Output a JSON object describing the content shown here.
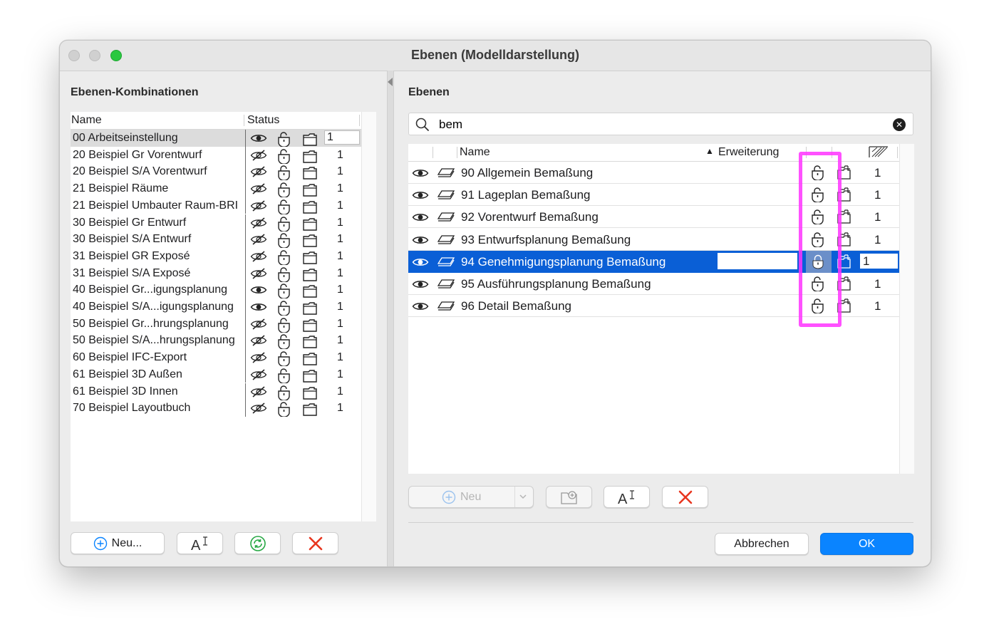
{
  "window": {
    "title": "Ebenen (Modelldarstellung)"
  },
  "left": {
    "section_title": "Ebenen-Kombinationen",
    "columns": {
      "name": "Name",
      "status": "Status"
    },
    "rows": [
      {
        "name": "00 Arbeitseinstellung",
        "visible": true,
        "num": "1",
        "selected": true
      },
      {
        "name": "20 Beispiel Gr Vorentwurf",
        "visible": false,
        "num": "1"
      },
      {
        "name": "20 Beispiel S/A Vorentwurf",
        "visible": false,
        "num": "1"
      },
      {
        "name": "21 Beispiel Räume",
        "visible": false,
        "num": "1"
      },
      {
        "name": "21 Beispiel Umbauter Raum-BRI",
        "visible": false,
        "num": "1"
      },
      {
        "name": "30 Beispiel Gr Entwurf",
        "visible": false,
        "num": "1"
      },
      {
        "name": "30 Beispiel S/A Entwurf",
        "visible": false,
        "num": "1"
      },
      {
        "name": "31 Beispiel GR Exposé",
        "visible": false,
        "num": "1"
      },
      {
        "name": "31 Beispiel S/A Exposé",
        "visible": false,
        "num": "1"
      },
      {
        "name": "40 Beispiel Gr...igungsplanung",
        "visible": true,
        "num": "1"
      },
      {
        "name": "40 Beispiel S/A...igungsplanung",
        "visible": true,
        "num": "1"
      },
      {
        "name": "50 Beispiel Gr...hrungsplanung",
        "visible": false,
        "num": "1"
      },
      {
        "name": "50 Beispiel S/A...hrungsplanung",
        "visible": false,
        "num": "1"
      },
      {
        "name": "60 Beispiel IFC-Export",
        "visible": false,
        "num": "1"
      },
      {
        "name": "61 Beispiel 3D Außen",
        "visible": false,
        "num": "1"
      },
      {
        "name": "61 Beispiel 3D Innen",
        "visible": false,
        "num": "1"
      },
      {
        "name": "70 Beispiel Layoutbuch",
        "visible": false,
        "num": "1"
      }
    ],
    "buttons": {
      "new": "Neu..."
    }
  },
  "right": {
    "section_title": "Ebenen",
    "search": {
      "value": "bem",
      "placeholder": ""
    },
    "columns": {
      "name": "Name",
      "extension": "Erweiterung"
    },
    "rows": [
      {
        "name": "90 Allgemein Bemaßung",
        "num": "1"
      },
      {
        "name": "91 Lageplan Bemaßung",
        "num": "1"
      },
      {
        "name": "92 Vorentwurf Bemaßung",
        "num": "1"
      },
      {
        "name": "93 Entwurfsplanung Bemaßung",
        "num": "1"
      },
      {
        "name": "94 Genehmigungsplanung Bemaßung",
        "num": "1",
        "selected": true
      },
      {
        "name": "95 Ausführungsplanung Bemaßung",
        "num": "1"
      },
      {
        "name": "96 Detail Bemaßung",
        "num": "1"
      }
    ],
    "buttons": {
      "new": "Neu"
    }
  },
  "footer": {
    "cancel": "Abbrechen",
    "ok": "OK"
  },
  "colors": {
    "selection": "#0a5fd6",
    "highlight": "#ff33ff",
    "delete": "#e8361f",
    "ok": "#0a84ff"
  }
}
